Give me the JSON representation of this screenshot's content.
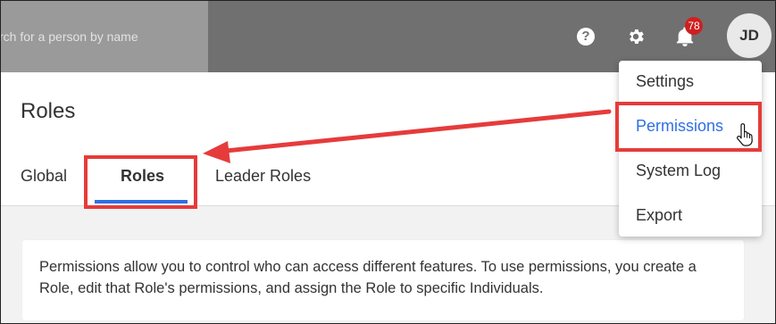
{
  "topbar": {
    "search_placeholder": "rch for a person by name",
    "help_icon_glyph": "?",
    "notification_count": "78",
    "avatar_initials": "JD"
  },
  "page": {
    "title": "Roles",
    "tabs": [
      {
        "label": "Global"
      },
      {
        "label": "Roles",
        "active": true
      },
      {
        "label": "Leader Roles"
      }
    ],
    "info_text": "Permissions allow you to control who can access different features. To use permissions, you create a Role, edit that Role's permissions, and assign the Role to specific Individuals."
  },
  "menu": {
    "items": [
      {
        "label": "Settings"
      },
      {
        "label": "Permissions",
        "highlighted": true
      },
      {
        "label": "System Log"
      },
      {
        "label": "Export"
      }
    ]
  },
  "colors": {
    "topbar": "#707070",
    "accent_blue": "#2f6fe4",
    "annotation_red": "#e63b3b",
    "badge_red": "#d01f1f"
  },
  "icons": [
    "help-icon",
    "gear-icon",
    "bell-icon",
    "hand-cursor-icon"
  ]
}
